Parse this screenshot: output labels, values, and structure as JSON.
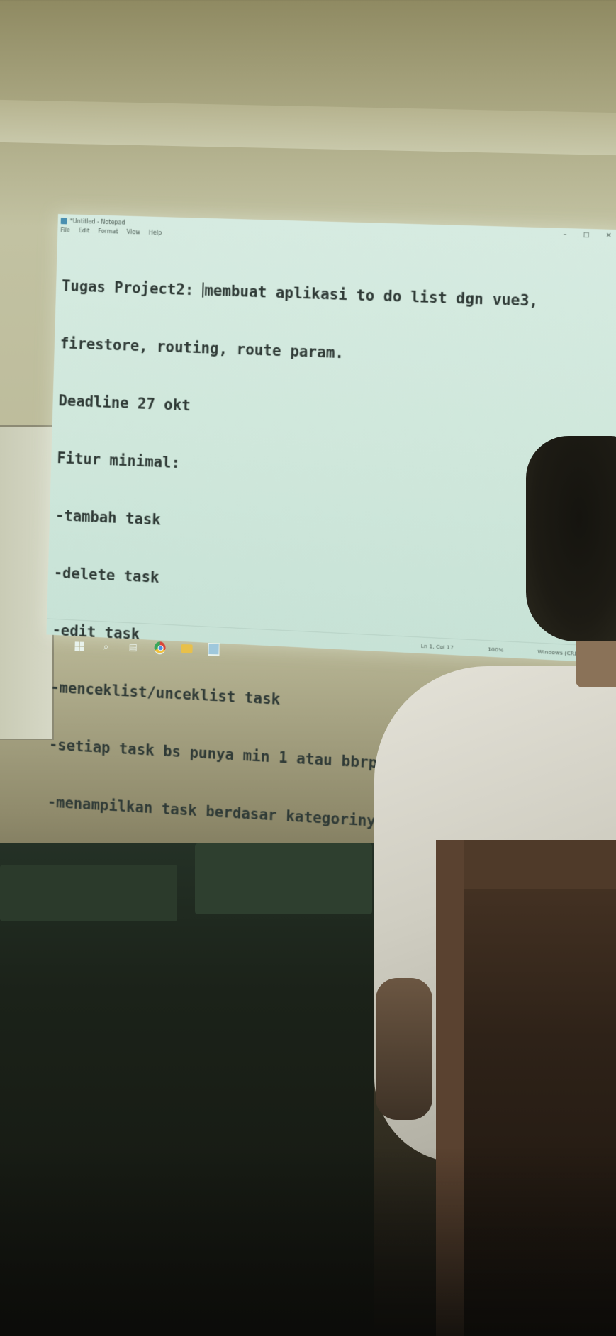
{
  "notepad": {
    "title": "*Untitled - Notepad",
    "menu": [
      "File",
      "Edit",
      "Format",
      "View",
      "Help"
    ],
    "window_controls": [
      "–",
      "□",
      "✕"
    ],
    "text_lines": [
      "Tugas Project2: membuat aplikasi to do list dgn vue3,",
      "firestore, routing, route param.",
      "Deadline 27 okt",
      "Fitur minimal:",
      "-tambah task",
      "-delete task",
      "-edit task",
      "-menceklist/unceklist task",
      "-setiap task bs punya min 1 atau bbrp kategori",
      "-menampilkan task berdasar kategorinya"
    ],
    "status": {
      "position": "Ln 1, Col 17",
      "zoom": "100%",
      "line_endings": "Windows (CRLF)"
    }
  },
  "taskbar": {
    "icons": [
      "windows-start-icon",
      "search-icon",
      "task-view-icon",
      "chrome-icon",
      "file-explorer-icon",
      "notepad-icon"
    ]
  }
}
